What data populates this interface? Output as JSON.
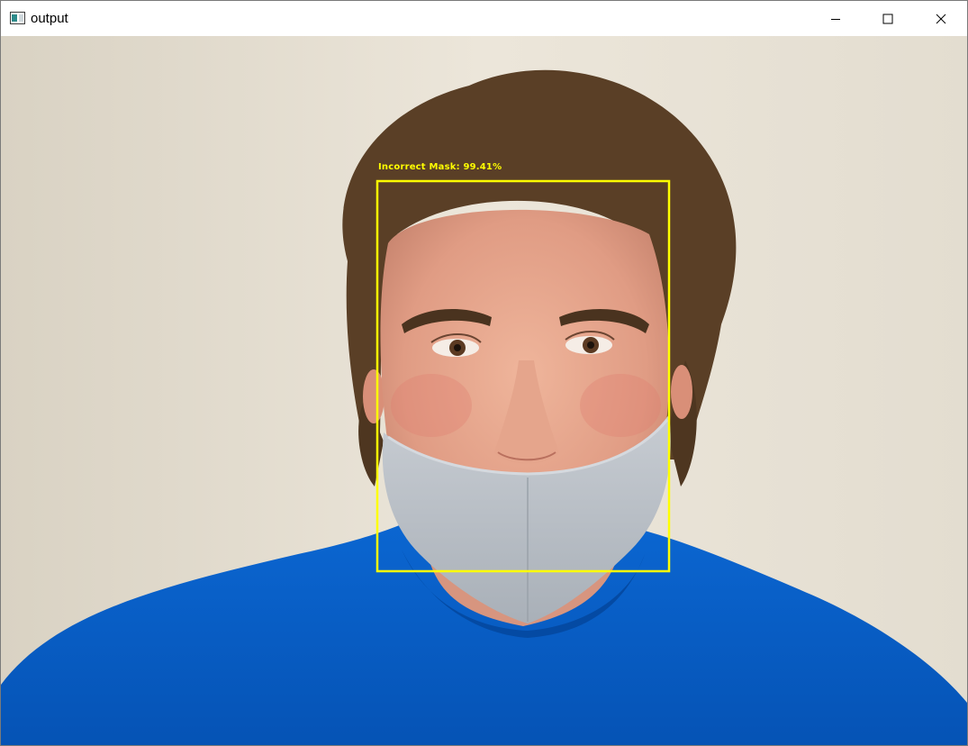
{
  "window": {
    "title": "output",
    "controls": {
      "minimize": "minimize-icon",
      "maximize": "maximize-icon",
      "close": "close-icon"
    }
  },
  "detection": {
    "label": "Incorrect Mask: 99.41%",
    "box_color": "#ffff00"
  },
  "colors": {
    "wall": "#e8e2d6",
    "shirt": "#0a5fc8",
    "mask": "#b9bfc6",
    "hair": "#5a3f26",
    "skin": "#e8a98f"
  }
}
